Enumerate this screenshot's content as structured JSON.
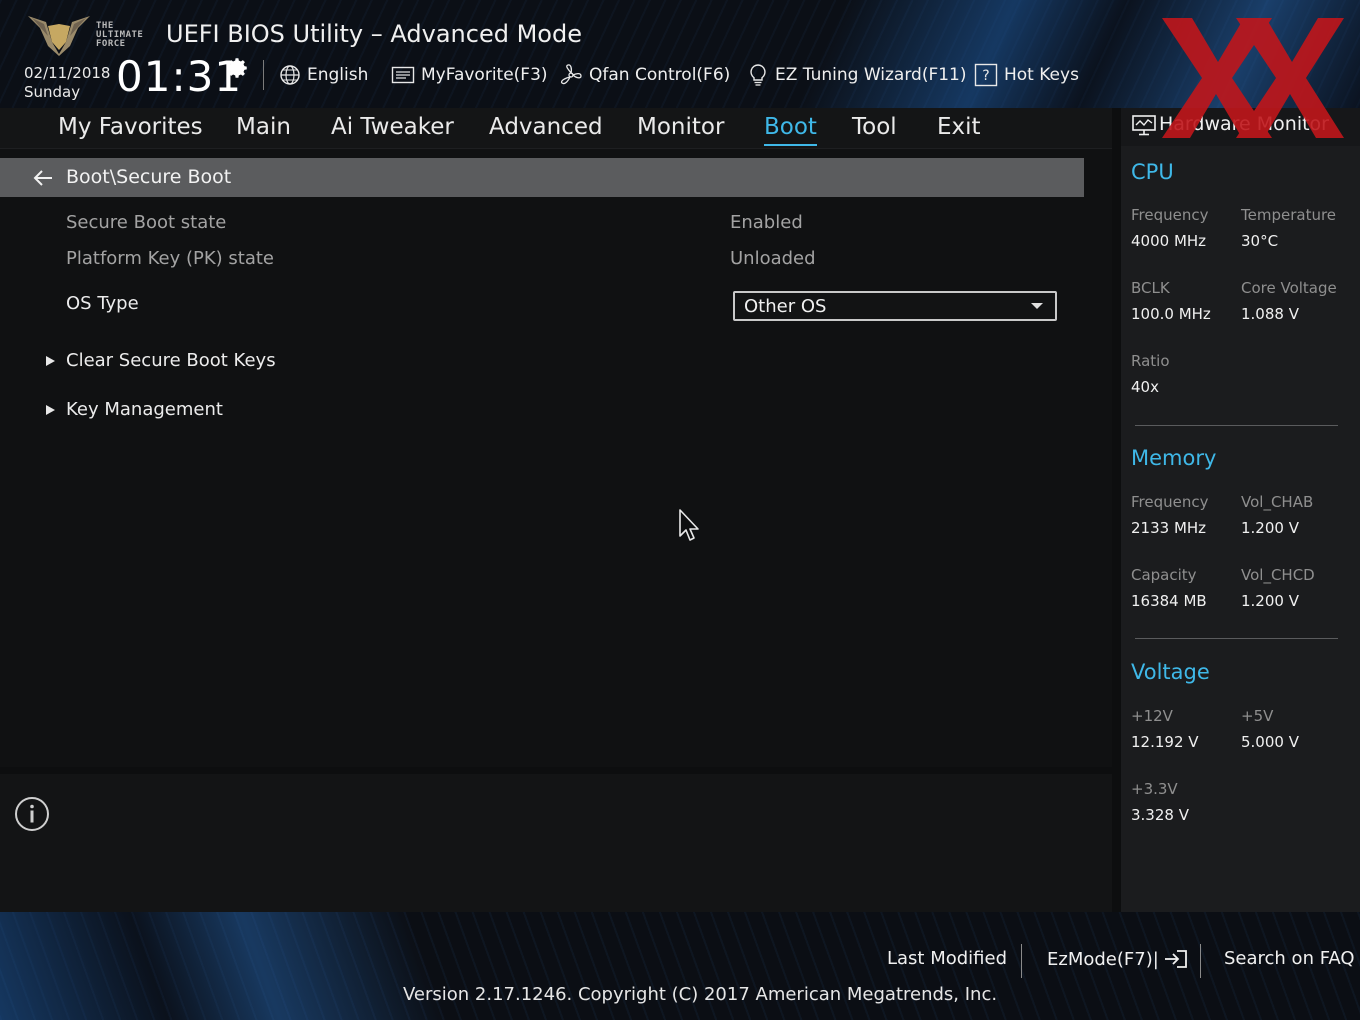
{
  "header": {
    "logo_tagline": "THE ULTIMATE FORCE",
    "title": "UEFI BIOS Utility – Advanced Mode",
    "date": "02/11/2018",
    "day": "Sunday",
    "time": "01:31",
    "toolbar": [
      {
        "label": "English",
        "icon": "globe-icon"
      },
      {
        "label": "MyFavorite(F3)",
        "icon": "favorite-list-icon"
      },
      {
        "label": "Qfan Control(F6)",
        "icon": "fan-icon"
      },
      {
        "label": "EZ Tuning Wizard(F11)",
        "icon": "lightbulb-icon"
      },
      {
        "label": "Hot Keys",
        "icon": "help-key-icon"
      }
    ]
  },
  "nav": {
    "tabs": [
      {
        "label": "My Favorites"
      },
      {
        "label": "Main"
      },
      {
        "label": "Ai Tweaker"
      },
      {
        "label": "Advanced"
      },
      {
        "label": "Monitor"
      },
      {
        "label": "Boot"
      },
      {
        "label": "Tool"
      },
      {
        "label": "Exit"
      }
    ],
    "active": "Boot"
  },
  "main": {
    "breadcrumb": "Boot\\Secure Boot",
    "secure_boot_state": {
      "label": "Secure Boot state",
      "value": "Enabled"
    },
    "pk_state": {
      "label": "Platform Key (PK) state",
      "value": "Unloaded"
    },
    "os_type": {
      "label": "OS Type",
      "value": "Other OS"
    },
    "submenus": [
      {
        "label": "Clear Secure Boot Keys"
      },
      {
        "label": "Key Management"
      }
    ]
  },
  "hardware_monitor": {
    "title": "Hardware Monitor",
    "cpu": {
      "heading": "CPU",
      "frequency": {
        "label": "Frequency",
        "value": "4000 MHz"
      },
      "temperature": {
        "label": "Temperature",
        "value": "30°C"
      },
      "bclk": {
        "label": "BCLK",
        "value": "100.0 MHz"
      },
      "core_voltage": {
        "label": "Core Voltage",
        "value": "1.088 V"
      },
      "ratio": {
        "label": "Ratio",
        "value": "40x"
      }
    },
    "memory": {
      "heading": "Memory",
      "frequency": {
        "label": "Frequency",
        "value": "2133 MHz"
      },
      "vol_chab": {
        "label": "Vol_CHAB",
        "value": "1.200 V"
      },
      "capacity": {
        "label": "Capacity",
        "value": "16384 MB"
      },
      "vol_chcd": {
        "label": "Vol_CHCD",
        "value": "1.200 V"
      }
    },
    "voltage": {
      "heading": "Voltage",
      "v12": {
        "label": "+12V",
        "value": "12.192 V"
      },
      "v5": {
        "label": "+5V",
        "value": "5.000 V"
      },
      "v33": {
        "label": "+3.3V",
        "value": "3.328 V"
      }
    }
  },
  "footer": {
    "last_modified": "Last Modified",
    "ezmode": "EzMode(F7)|",
    "search_faq": "Search on FAQ",
    "version": "Version 2.17.1246. Copyright (C) 2017 American Megatrends, Inc."
  },
  "colors": {
    "accent": "#3fb8e8",
    "watermark": "#c0161b",
    "breadcrumb_bar": "#5b5c5e"
  }
}
